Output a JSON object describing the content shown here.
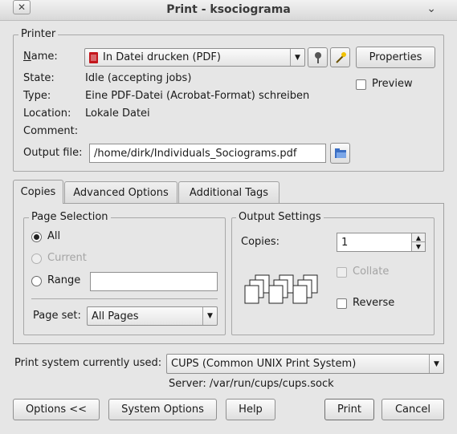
{
  "window": {
    "title": "Print - ksociograma",
    "close_glyph": "✕",
    "menu_glyph": "⌄"
  },
  "printer": {
    "group_label": "Printer",
    "name_label": "Name:",
    "name_value": "In Datei drucken (PDF)",
    "properties_label": "Properties",
    "preview_label": "Preview",
    "state_label": "State:",
    "state_value": "Idle (accepting jobs)",
    "type_label": "Type:",
    "type_value": "Eine PDF-Datei (Acrobat-Format) schreiben",
    "location_label": "Location:",
    "location_value": "Lokale Datei",
    "comment_label": "Comment:",
    "comment_value": "",
    "output_label": "Output file:",
    "output_value": "/home/dirk/Individuals_Sociograms.pdf"
  },
  "tabs": [
    {
      "label": "Copies"
    },
    {
      "label": "Advanced Options"
    },
    {
      "label": "Additional Tags"
    }
  ],
  "page_selection": {
    "group_label": "Page Selection",
    "all_label": "All",
    "current_label": "Current",
    "range_label": "Range",
    "range_value": "",
    "page_set_label": "Page set:",
    "page_set_value": "All Pages"
  },
  "output_settings": {
    "group_label": "Output Settings",
    "copies_label": "Copies:",
    "copies_value": "1",
    "collate_label": "Collate",
    "reverse_label": "Reverse"
  },
  "print_system": {
    "label": "Print system currently used:",
    "value": "CUPS (Common UNIX Print System)",
    "server_text": "Server: /var/run/cups/cups.sock"
  },
  "buttons": {
    "options": "Options <<",
    "system_options": "System Options",
    "help": "Help",
    "print": "Print",
    "cancel": "Cancel"
  }
}
